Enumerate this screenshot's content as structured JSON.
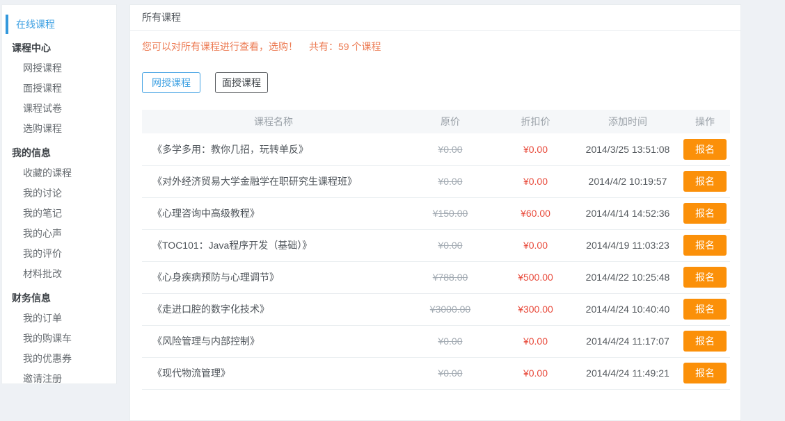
{
  "colors": {
    "accent_blue": "#3b9fe2",
    "active_bar_blue": "#3398dc",
    "notice_orange": "#ec7a52",
    "discount_red": "#e8493a",
    "enroll_orange": "#fb9009",
    "strikethrough_gray": "#a2aab2",
    "page_background": "#eef1f5",
    "table_header_bg": "#f5f7f9"
  },
  "sidebar": {
    "active_item": "在线课程",
    "sections": [
      {
        "title": "课程中心",
        "items": [
          "网授课程",
          "面授课程",
          "课程试卷",
          "选购课程"
        ]
      },
      {
        "title": "我的信息",
        "items": [
          "收藏的课程",
          "我的讨论",
          "我的笔记",
          "我的心声",
          "我的评价",
          "材料批改"
        ]
      },
      {
        "title": "财务信息",
        "items": [
          "我的订单",
          "我的购课车",
          "我的优惠券",
          "邀请注册"
        ]
      }
    ]
  },
  "main": {
    "title": "所有课程",
    "notice_text": "您可以对所有课程进行查看，选购！",
    "count_text": "共有：59 个课程",
    "course_count": "59",
    "filters": [
      {
        "label": "网授课程",
        "active": true
      },
      {
        "label": "面授课程",
        "active": false
      }
    ],
    "table": {
      "columns": [
        "课程名称",
        "原价",
        "折扣价",
        "添加时间",
        "操作"
      ],
      "action_label": "报名",
      "rows": [
        {
          "name": "《多学多用：教你几招，玩转单反》",
          "original": "¥0.00",
          "discount": "¥0.00",
          "added": "2014/3/25 13:51:08"
        },
        {
          "name": "《对外经济贸易大学金融学在职研究生课程班》",
          "original": "¥0.00",
          "discount": "¥0.00",
          "added": "2014/4/2 10:19:57"
        },
        {
          "name": "《心理咨询中高级教程》",
          "original": "¥150.00",
          "discount": "¥60.00",
          "added": "2014/4/14 14:52:36"
        },
        {
          "name": "《TOC101：Java程序开发（基础）》",
          "original": "¥0.00",
          "discount": "¥0.00",
          "added": "2014/4/19 11:03:23"
        },
        {
          "name": "《心身疾病预防与心理调节》",
          "original": "¥788.00",
          "discount": "¥500.00",
          "added": "2014/4/22 10:25:48"
        },
        {
          "name": "《走进口腔的数字化技术》",
          "original": "¥3000.00",
          "discount": "¥300.00",
          "added": "2014/4/24 10:40:40"
        },
        {
          "name": "《风险管理与内部控制》",
          "original": "¥0.00",
          "discount": "¥0.00",
          "added": "2014/4/24 11:17:07"
        },
        {
          "name": "《现代物流管理》",
          "original": "¥0.00",
          "discount": "¥0.00",
          "added": "2014/4/24 11:49:21"
        }
      ]
    }
  }
}
